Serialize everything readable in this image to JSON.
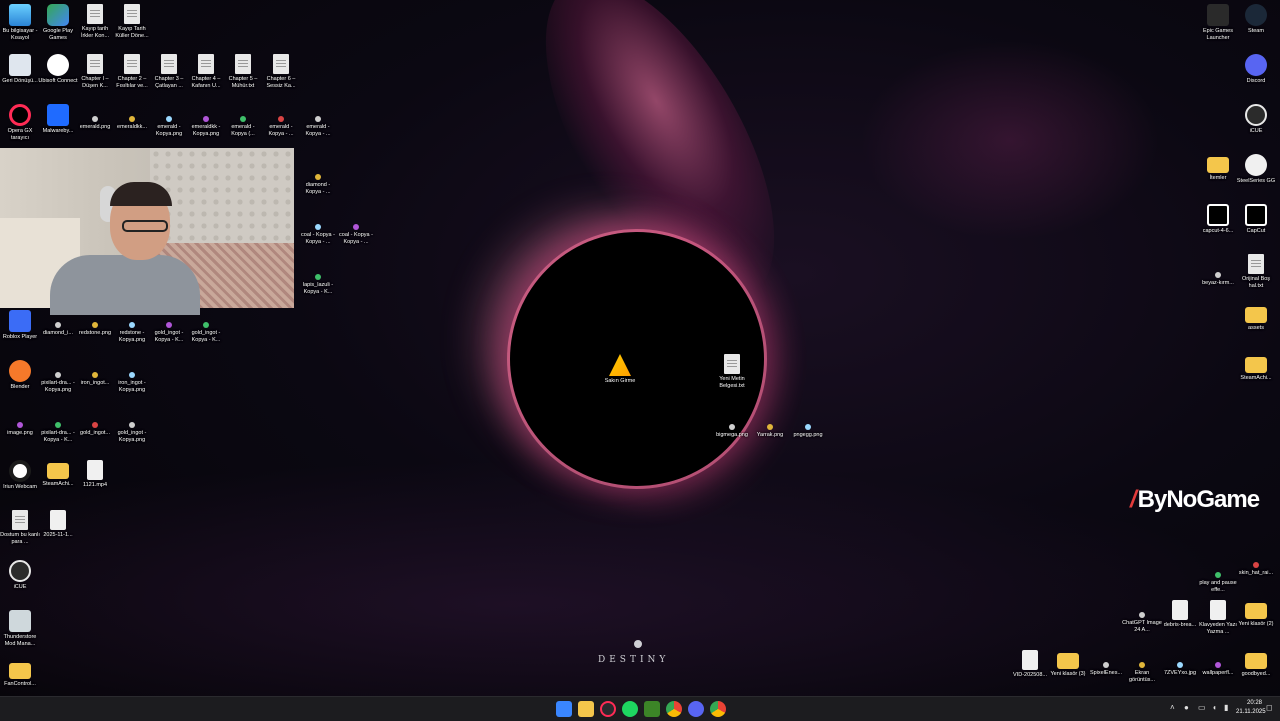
{
  "wallpaper": {
    "brand_text": "DESTINY"
  },
  "desktop_icons_left": [
    {
      "label": "Bu bilgisayar - Kısayol",
      "icon": "computer-icon"
    },
    {
      "label": "Google Play Games",
      "icon": "google-play-games-icon"
    },
    {
      "label": "Kayıp tarih İrkler Kon...",
      "icon": "text-file-icon"
    },
    {
      "label": "Kayıp Tarih Küller Döne...",
      "icon": "text-file-icon"
    },
    {
      "label": "Geri Dönüşü...",
      "icon": "recycle-bin-icon"
    },
    {
      "label": "Ubisoft Connect",
      "icon": "ubisoft-icon"
    },
    {
      "label": "Chapter I – Düşen K...",
      "icon": "text-file-icon"
    },
    {
      "label": "Chapter 2 – Fısıltılar ve...",
      "icon": "text-file-icon"
    },
    {
      "label": "Chapter 3 – Çatlayan ...",
      "icon": "text-file-icon"
    },
    {
      "label": "Chapter 4 – Kafanın U...",
      "icon": "text-file-icon"
    },
    {
      "label": "Chapter 5 – Mühür.txt",
      "icon": "text-file-icon"
    },
    {
      "label": "Chapter 6 – Sessiz Ka...",
      "icon": "text-file-icon"
    },
    {
      "label": "Opera GX tarayıcı",
      "icon": "opera-gx-icon"
    },
    {
      "label": "Malwareby...",
      "icon": "malwarebytes-icon"
    },
    {
      "label": "emerald.png",
      "icon": "image-icon"
    },
    {
      "label": "emeraldkk...",
      "icon": "image-icon"
    },
    {
      "label": "emerald - Kopya.png",
      "icon": "image-icon"
    },
    {
      "label": "emeraldkk - Kopya.png",
      "icon": "image-icon"
    },
    {
      "label": "emerald - Kopya (...",
      "icon": "image-icon"
    },
    {
      "label": "emerald - Kopya - ...",
      "icon": "image-icon"
    },
    {
      "label": "emerald - Kopya - ...",
      "icon": "image-icon"
    },
    {
      "label": "diamond - Kopya - ...",
      "icon": "image-icon"
    },
    {
      "label": "coal - Kopya - Kopya - ...",
      "icon": "image-icon"
    },
    {
      "label": "coal - Kopya - Kopya - ...",
      "icon": "image-icon"
    },
    {
      "label": "lapis_lazuli - Kopya - K...",
      "icon": "image-icon"
    },
    {
      "label": "Roblox Player",
      "icon": "roblox-icon"
    },
    {
      "label": "diamond_i...",
      "icon": "image-icon"
    },
    {
      "label": "redstone.png",
      "icon": "image-icon"
    },
    {
      "label": "redstone - Kopya.png",
      "icon": "image-icon"
    },
    {
      "label": "gold_ingot - Kopya - K...",
      "icon": "image-icon"
    },
    {
      "label": "gold_ingot - Kopya - K...",
      "icon": "image-icon"
    },
    {
      "label": "Blender",
      "icon": "blender-icon"
    },
    {
      "label": "pixilart-dra... - Kopya.png",
      "icon": "image-icon"
    },
    {
      "label": "iron_ingot...",
      "icon": "image-icon"
    },
    {
      "label": "iron_ingot - Kopya.png",
      "icon": "image-icon"
    },
    {
      "label": "image.png",
      "icon": "image-icon"
    },
    {
      "label": "pixilart-dra... - Kopya - K...",
      "icon": "image-icon"
    },
    {
      "label": "gold_ingot...",
      "icon": "image-icon"
    },
    {
      "label": "gold_ingot - Kopya.png",
      "icon": "image-icon"
    },
    {
      "label": "Iriun Webcam",
      "icon": "iriun-webcam-icon"
    },
    {
      "label": "SteamAchi...",
      "icon": "folder-icon"
    },
    {
      "label": "1121.mp4",
      "icon": "video-file-icon"
    },
    {
      "label": "Dostum bu kanlı para ...",
      "icon": "text-file-icon"
    },
    {
      "label": "2025-11-1...",
      "icon": "video-file-icon"
    },
    {
      "label": "iCUE",
      "icon": "icue-icon"
    },
    {
      "label": "Thunderstore Mod Mana...",
      "icon": "thunderstore-icon"
    },
    {
      "label": "FanControl...",
      "icon": "folder-icon"
    }
  ],
  "desktop_icons_center": [
    {
      "label": "Sakın Girme",
      "icon": "warning-icon"
    },
    {
      "label": "Yeni Metin Belgesi.txt",
      "icon": "text-file-icon"
    },
    {
      "label": "bigmega.png",
      "icon": "image-icon"
    },
    {
      "label": "Yarrak.png",
      "icon": "image-icon"
    },
    {
      "label": "pngegg.png",
      "icon": "image-icon"
    }
  ],
  "desktop_icons_right": [
    {
      "label": "Epic Games Launcher",
      "icon": "epic-games-icon"
    },
    {
      "label": "Steam",
      "icon": "steam-icon"
    },
    {
      "label": "Discord",
      "icon": "discord-icon"
    },
    {
      "label": "iCUE",
      "icon": "icue-icon"
    },
    {
      "label": "İtemler",
      "icon": "folder-icon"
    },
    {
      "label": "SteelSeries GG",
      "icon": "steelseries-icon"
    },
    {
      "label": "capcut-4-6...",
      "icon": "capcut-icon"
    },
    {
      "label": "CapCut",
      "icon": "capcut-icon"
    },
    {
      "label": "beyaz-kırm...",
      "icon": "image-icon"
    },
    {
      "label": "Orijinal Boş hal.txt",
      "icon": "text-file-icon"
    },
    {
      "label": "assets",
      "icon": "folder-icon"
    },
    {
      "label": "SteamAchi...",
      "icon": "folder-icon"
    },
    {
      "label": "play and pause effe...",
      "icon": "image-icon"
    },
    {
      "label": "skin_hat_rai...",
      "icon": "image-icon"
    },
    {
      "label": "ChatGPT Image 24 A...",
      "icon": "image-icon"
    },
    {
      "label": "debris-brea...",
      "icon": "video-file-icon"
    },
    {
      "label": "Klavyeden Yazı Yazma ...",
      "icon": "video-file-icon"
    },
    {
      "label": "Yeni klasör (2)",
      "icon": "folder-icon"
    },
    {
      "label": "VID-202508...",
      "icon": "video-file-icon"
    },
    {
      "label": "Yeni klasör (3)",
      "icon": "folder-icon"
    },
    {
      "label": "SpixelEnes...",
      "icon": "image-icon"
    },
    {
      "label": "Ekran görüntüs...",
      "icon": "image-icon"
    },
    {
      "label": "7ZVEYxo.jpg",
      "icon": "image-icon"
    },
    {
      "label": "wallpaperfl...",
      "icon": "image-icon"
    },
    {
      "label": "goodbyed...",
      "icon": "folder-icon"
    }
  ],
  "overlay": {
    "brand": "ByNoGame"
  },
  "taskbar": {
    "apps": [
      "start-icon",
      "file-explorer-icon",
      "opera-gx-icon",
      "spotify-icon",
      "minecraft-icon",
      "chrome-icon",
      "discord-icon",
      "chrome-alt-icon"
    ],
    "time": "20:28",
    "date": "21.11.2025"
  }
}
